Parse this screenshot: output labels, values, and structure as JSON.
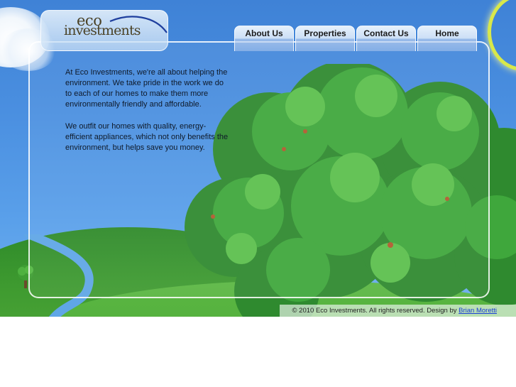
{
  "logo": {
    "line1": "eco",
    "line2": "investments"
  },
  "nav": {
    "items": [
      {
        "label": "About Us"
      },
      {
        "label": "Properties"
      },
      {
        "label": "Contact Us"
      },
      {
        "label": "Home"
      }
    ]
  },
  "content": {
    "paragraph1": "At Eco Investments, we're all about helping the environment. We take pride in the work we do to each of our homes to make them more environmentally friendly and affordable.",
    "paragraph2": "We outfit our homes with quality, energy-efficient appliances, which not only benefits the environment, but helps save you money."
  },
  "footer": {
    "copyright": "© 2010 Eco Investments. All rights reserved. Design by",
    "designer_link": "Brian Moretti"
  },
  "colors": {
    "sky": "#4a8fe0",
    "foliage": "#3faa3a",
    "logo_text": "#4a4226",
    "link": "#1a3fd6"
  }
}
